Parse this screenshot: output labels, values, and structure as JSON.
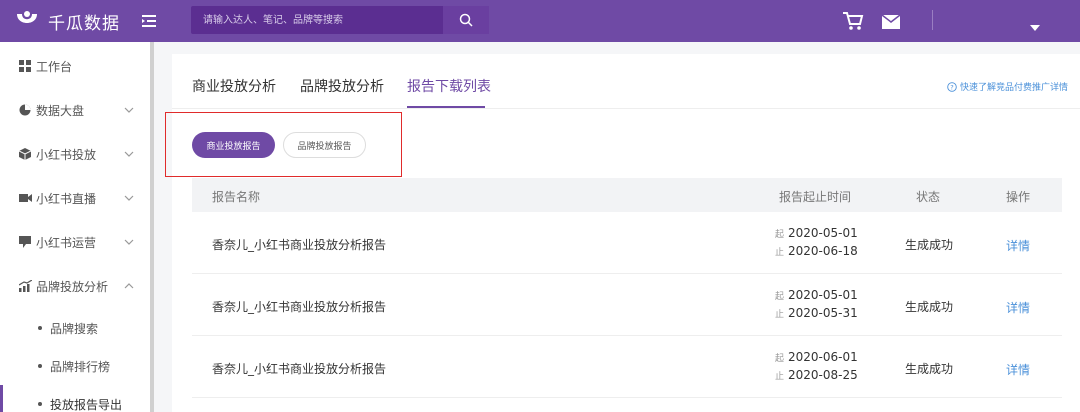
{
  "app": {
    "brand": "千瓜数据"
  },
  "search": {
    "placeholder": "请输入达人、笔记、品牌等搜索"
  },
  "sidebar": {
    "items": [
      {
        "label": "工作台"
      },
      {
        "label": "数据大盘"
      },
      {
        "label": "小红书投放"
      },
      {
        "label": "小红书直播"
      },
      {
        "label": "小红书运营"
      },
      {
        "label": "品牌投放分析"
      }
    ],
    "sub_items": [
      {
        "label": "品牌搜索"
      },
      {
        "label": "品牌排行榜"
      },
      {
        "label": "投放报告导出"
      }
    ]
  },
  "tabs": [
    {
      "label": "商业投放分析"
    },
    {
      "label": "品牌投放分析"
    },
    {
      "label": "报告下载列表"
    }
  ],
  "help_link": "快速了解竞品付费推广详情",
  "filters": {
    "primary": "商业投放报告",
    "secondary": "品牌投放报告"
  },
  "table": {
    "headers": [
      "报告名称",
      "报告起止时间",
      "状态",
      "操作"
    ],
    "start_prefix": "起",
    "end_prefix": "止",
    "rows": [
      {
        "name": "香奈儿_小红书商业投放分析报告",
        "start": "2020-05-01",
        "end": "2020-06-18",
        "status": "生成成功",
        "action": "详情"
      },
      {
        "name": "香奈儿_小红书商业投放分析报告",
        "start": "2020-05-01",
        "end": "2020-05-31",
        "status": "生成成功",
        "action": "详情"
      },
      {
        "name": "香奈儿_小红书商业投放分析报告",
        "start": "2020-06-01",
        "end": "2020-08-25",
        "status": "生成成功",
        "action": "详情"
      }
    ]
  },
  "colors": {
    "brand": "#6f4aa5",
    "link": "#4a90d9",
    "highlight": "#e02b2b"
  }
}
